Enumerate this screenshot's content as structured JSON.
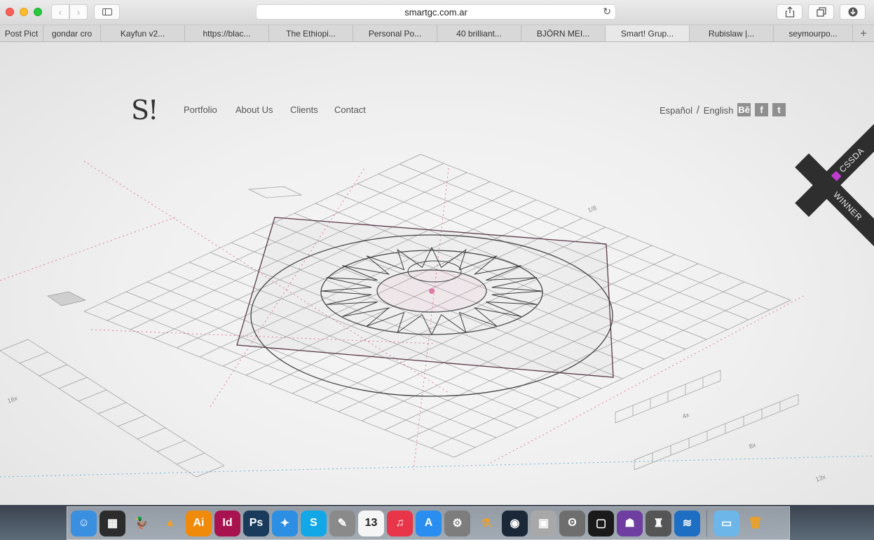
{
  "browser": {
    "url": "smartgc.com.ar",
    "tabs": [
      {
        "label": "Post Pict",
        "width": 62
      },
      {
        "label": "gondar cro",
        "width": 82
      },
      {
        "label": "Kayfun v2...",
        "width": 120
      },
      {
        "label": "https://blac...",
        "width": 120
      },
      {
        "label": "The Ethiopi...",
        "width": 120
      },
      {
        "label": "Personal Po...",
        "width": 120
      },
      {
        "label": "40 brilliant...",
        "width": 120
      },
      {
        "label": "BJÖRN MEI...",
        "width": 120
      },
      {
        "label": "Smart! Grup...",
        "width": 120,
        "active": true
      },
      {
        "label": "Rubislaw |...",
        "width": 120
      },
      {
        "label": "seymourpo...",
        "width": 113
      }
    ],
    "new_tab": "+"
  },
  "site": {
    "logo": "S!",
    "nav": [
      "Portfolio",
      "About Us",
      "Clients",
      "Contact"
    ],
    "lang_es": "Español",
    "lang_sep": "/",
    "lang_en": "English",
    "social": [
      "Bē",
      "f",
      "t"
    ],
    "ribbon_top": "CSSDA",
    "ribbon_bottom": "WINNER",
    "drawing_labels": [
      "16x",
      "4x",
      "8x",
      "13x",
      "1/8"
    ]
  },
  "dock": {
    "icons": [
      {
        "name": "finder-icon",
        "glyph": "☺",
        "bg": "#3b8fe0"
      },
      {
        "name": "mission-control-icon",
        "glyph": "▦",
        "bg": "#2c2c2c"
      },
      {
        "name": "cyberduck-icon",
        "glyph": "🦆",
        "bg": "transparent"
      },
      {
        "name": "vlc-icon",
        "glyph": "▲",
        "bg": "transparent"
      },
      {
        "name": "illustrator-icon",
        "glyph": "Ai",
        "bg": "#f08a0a"
      },
      {
        "name": "indesign-icon",
        "glyph": "Id",
        "bg": "#a8124f"
      },
      {
        "name": "photoshop-icon",
        "glyph": "Ps",
        "bg": "#1a3b5c"
      },
      {
        "name": "safari-icon",
        "glyph": "✦",
        "bg": "#2d8fe3"
      },
      {
        "name": "skype-icon",
        "glyph": "S",
        "bg": "#12a8e8"
      },
      {
        "name": "script-editor-icon",
        "glyph": "✎",
        "bg": "#8a8a8a"
      },
      {
        "name": "calendar-icon",
        "glyph": "13",
        "bg": "#f5f5f5"
      },
      {
        "name": "itunes-icon",
        "glyph": "♫",
        "bg": "#e8354a"
      },
      {
        "name": "app-store-icon",
        "glyph": "A",
        "bg": "#2a8ef0"
      },
      {
        "name": "system-preferences-icon",
        "glyph": "⚙",
        "bg": "#7d7d7d"
      },
      {
        "name": "potion-icon",
        "glyph": "⚗",
        "bg": "transparent"
      },
      {
        "name": "steam-icon",
        "glyph": "◉",
        "bg": "#1b2838"
      },
      {
        "name": "image-capture-icon",
        "glyph": "▣",
        "bg": "#a8a8a8"
      },
      {
        "name": "koala-icon",
        "glyph": "ʘ",
        "bg": "#6e6e6e"
      },
      {
        "name": "framer-icon",
        "glyph": "▢",
        "bg": "#1a1a1a"
      },
      {
        "name": "github-icon",
        "glyph": "☗",
        "bg": "#6e3fa0"
      },
      {
        "name": "sequel-icon",
        "glyph": "♜",
        "bg": "#555"
      },
      {
        "name": "openoffice-icon",
        "glyph": "≋",
        "bg": "#1e6fc4"
      }
    ],
    "right_icons": [
      {
        "name": "downloads-folder-icon",
        "glyph": "▭",
        "bg": "#6db6ea"
      },
      {
        "name": "trash-icon",
        "glyph": "🗑",
        "bg": "transparent"
      }
    ]
  }
}
